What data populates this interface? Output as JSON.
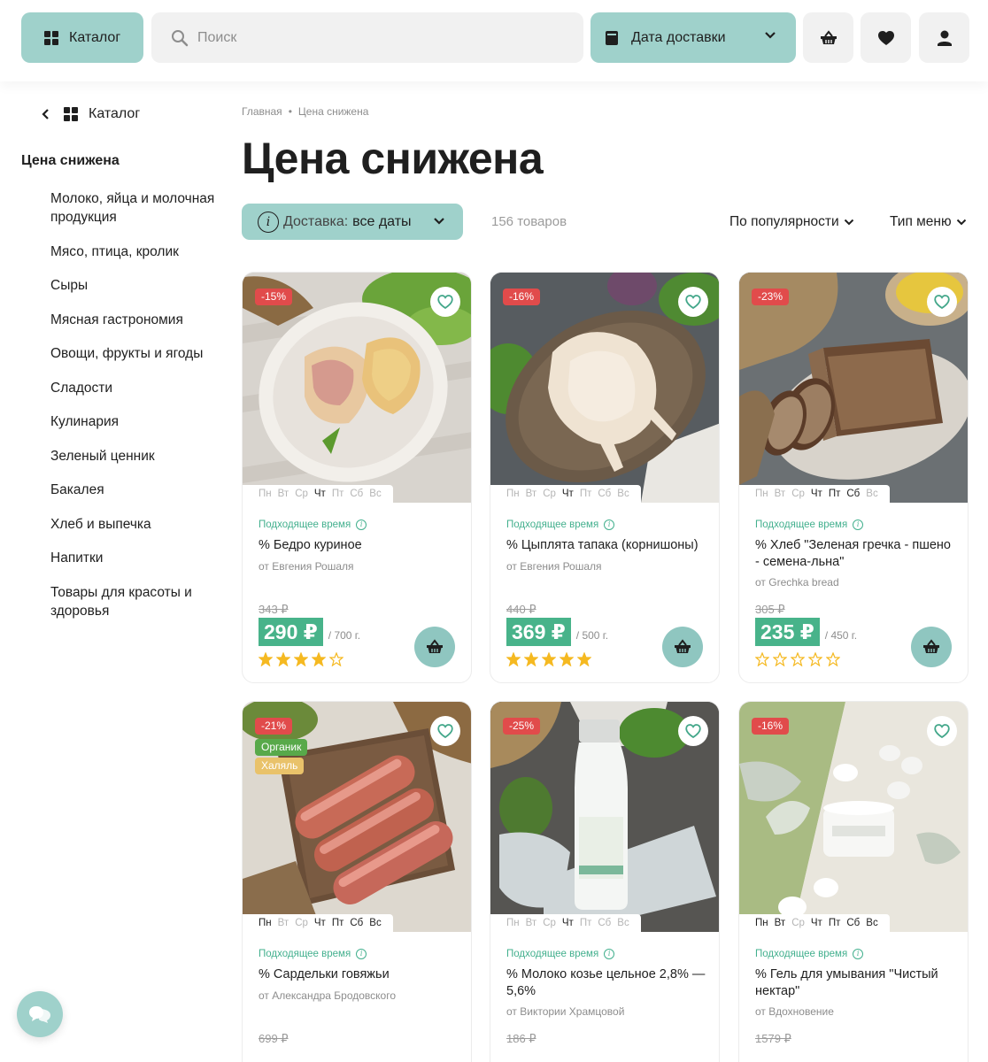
{
  "header": {
    "catalog_label": "Каталог",
    "search_placeholder": "Поиск",
    "delivery_date_label": "Дата доставки"
  },
  "sidebar": {
    "back_label": "Каталог",
    "current": "Цена снижена",
    "items": [
      "Молоко, яйца и молочная продукция",
      "Мясо, птица, кролик",
      "Сыры",
      "Мясная гастрономия",
      "Овощи, фрукты и ягоды",
      "Сладости",
      "Кулинария",
      "Зеленый ценник",
      "Бакалея",
      "Хлеб и выпечка",
      "Напитки",
      "Товары для красоты и здоровья"
    ]
  },
  "breadcrumb": [
    "Главная",
    "Цена снижена"
  ],
  "page_title": "Цена снижена",
  "filters": {
    "delivery_label": "Доставка:",
    "delivery_value": "все даты",
    "product_count": "156 товаров",
    "sort_label": "По популярности",
    "menu_type_label": "Тип меню"
  },
  "days_labels": [
    "Пн",
    "Вт",
    "Ср",
    "Чт",
    "Пт",
    "Сб",
    "Вс"
  ],
  "suitable_time_label": "Подходящее время",
  "products": [
    {
      "discount": "-15%",
      "tags": [],
      "active_days": [
        3
      ],
      "name": "% Бедро куриное",
      "maker": "от Евгения Рошаля",
      "old_price": "343 ₽",
      "price": "290 ₽",
      "unit": "/ 700 г.",
      "rating": 4
    },
    {
      "discount": "-16%",
      "tags": [],
      "active_days": [
        3
      ],
      "name": "% Цыплята тапака (корнишоны)",
      "maker": "от Евгения Рошаля",
      "old_price": "440 ₽",
      "price": "369 ₽",
      "unit": "/ 500 г.",
      "rating": 5
    },
    {
      "discount": "-23%",
      "tags": [],
      "active_days": [
        3,
        4,
        5
      ],
      "name": "% Хлеб \"Зеленая гречка - пшено - семена-льна\"",
      "maker": "от Grechka bread",
      "old_price": "305 ₽",
      "price": "235 ₽",
      "unit": "/ 450 г.",
      "rating": 0
    },
    {
      "discount": "-21%",
      "tags": [
        "Органик",
        "Халяль"
      ],
      "active_days": [
        0,
        3,
        4,
        5,
        6
      ],
      "name": "% Сардельки говяжьи",
      "maker": "от Александра Бродовского",
      "old_price": "699 ₽"
    },
    {
      "discount": "-25%",
      "tags": [],
      "active_days": [
        3
      ],
      "name": "% Молоко козье цельное 2,8% — 5,6%",
      "maker": "от Виктории Храмцовой",
      "old_price": "186 ₽"
    },
    {
      "discount": "-16%",
      "tags": [],
      "active_days": [
        0,
        1,
        3,
        4,
        5,
        6
      ],
      "name": "% Гель для умывания \"Чистый нектар\"",
      "maker": "от Вдохновение",
      "old_price": "1579 ₽"
    }
  ],
  "colors": {
    "accent_teal": "#9fd1cb",
    "price_green": "#48b38a",
    "discount_red": "#e14b4b",
    "organic_green": "#58a94a",
    "halal_yellow": "#e9c26a",
    "star_yellow": "#f5b921"
  }
}
